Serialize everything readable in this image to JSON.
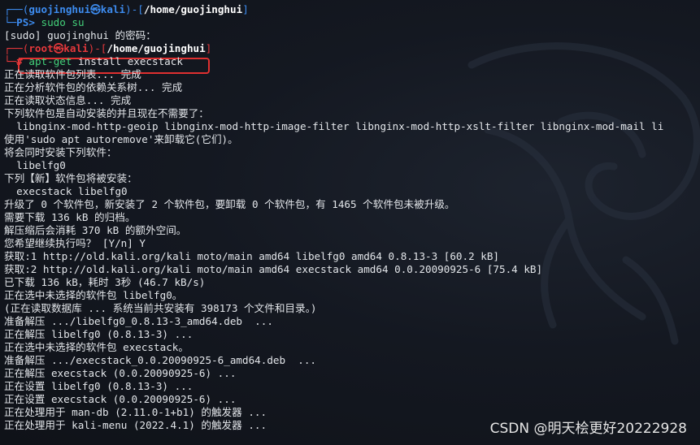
{
  "prompt1": {
    "corner_top": "┌──(",
    "user": "guojinghui",
    "at": "㉿",
    "host": "kali",
    "mid": ")-[",
    "path": "/home/guojinghui",
    "close": "]",
    "corner_bottom": "└─",
    "ps_label": "PS>",
    "command": "sudo su"
  },
  "sudo_prompt": "[sudo] guojinghui 的密码：",
  "prompt2": {
    "corner_top": "┌──(",
    "user": "root",
    "at": "㉿",
    "host": "kali",
    "mid": ")-[",
    "path": "/home/guojinghui",
    "close": "]",
    "corner_bottom": "└─",
    "hash": "#",
    "command_name": "apt-get",
    "command_args": "install execstack"
  },
  "output_lines": [
    "正在读取软件包列表... 完成",
    "正在分析软件包的依赖关系树... 完成",
    "正在读取状态信息... 完成",
    "下列软件包是自动安装的并且现在不需要了：",
    "  libnginx-mod-http-geoip libnginx-mod-http-image-filter libnginx-mod-http-xslt-filter libnginx-mod-mail li",
    "使用'sudo apt autoremove'来卸载它(它们)。",
    "将会同时安装下列软件：",
    "  libelfg0",
    "下列【新】软件包将被安装：",
    "  execstack libelfg0",
    "升级了 0 个软件包，新安装了 2 个软件包，要卸载 0 个软件包，有 1465 个软件包未被升级。",
    "需要下载 136 kB 的归档。",
    "解压缩后会消耗 370 kB 的额外空间。",
    "您希望继续执行吗？ [Y/n] Y",
    "获取:1 http://old.kali.org/kali moto/main amd64 libelfg0 amd64 0.8.13-3 [60.2 kB]",
    "获取:2 http://old.kali.org/kali moto/main amd64 execstack amd64 0.0.20090925-6 [75.4 kB]",
    "已下载 136 kB，耗时 3秒 (46.7 kB/s)",
    "正在选中未选择的软件包 libelfg0。",
    "(正在读取数据库 ... 系统当前共安装有 398173 个文件和目录。)",
    "准备解压 .../libelfg0_0.8.13-3_amd64.deb  ...",
    "正在解压 libelfg0 (0.8.13-3) ...",
    "正在选中未选择的软件包 execstack。",
    "准备解压 .../execstack_0.0.20090925-6_amd64.deb  ...",
    "正在解压 execstack (0.0.20090925-6) ...",
    "正在设置 libelfg0 (0.8.13-3) ...",
    "正在设置 execstack (0.0.20090925-6) ...",
    "正在处理用于 man-db (2.11.0-1+b1) 的触发器 ...",
    "正在处理用于 kali-menu (2022.4.1) 的触发器 ..."
  ],
  "watermark": "CSDN @明天桧更好20222928",
  "colors": {
    "background": "#0f1218",
    "prompt_blue": "#3d8cf0",
    "root_red": "#e5383b",
    "command_green": "#43d17a",
    "highlight_border": "#e03030",
    "text": "#e3e6ea"
  },
  "icons": {
    "background_logo": "kali-dragon-icon"
  }
}
